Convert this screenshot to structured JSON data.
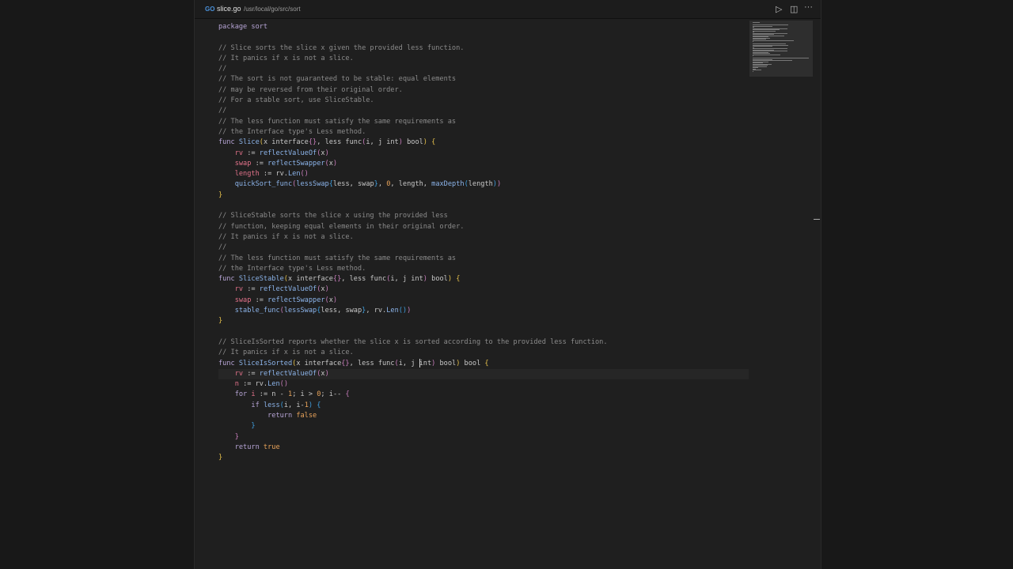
{
  "tab": {
    "icon": "GO",
    "file_name": "slice.go",
    "path": "/usr/local/go/src/sort"
  },
  "toolbar": {
    "run_icon": "play-icon",
    "split_icon": "split-editor-icon",
    "more_icon": "more-icon"
  },
  "colors": {
    "background": "#1f1f1f",
    "comment": "#8b8b8b",
    "keyword": "#b7a5d6",
    "function": "#8cb4ea",
    "variable": "#e2728a",
    "number": "#e8a35a"
  },
  "cursor_line": 33,
  "lines": [
    [
      [
        "package sort",
        "k"
      ]
    ],
    [],
    [
      [
        "// Slice sorts the slice x given the provided less function.",
        "c"
      ]
    ],
    [
      [
        "// It panics if x is not a slice.",
        "c"
      ]
    ],
    [
      [
        "//",
        "c"
      ]
    ],
    [
      [
        "// The sort is not guaranteed to be stable: equal elements",
        "c"
      ]
    ],
    [
      [
        "// may be reversed from their original order.",
        "c"
      ]
    ],
    [
      [
        "// For a stable sort, use SliceStable.",
        "c"
      ]
    ],
    [
      [
        "//",
        "c"
      ]
    ],
    [
      [
        "// The less function must satisfy the same requirements as",
        "c"
      ]
    ],
    [
      [
        "// the Interface type's Less method.",
        "c"
      ]
    ],
    [
      [
        "func ",
        "k"
      ],
      [
        "Slice",
        "f"
      ],
      [
        "(",
        "b1"
      ],
      [
        "x interface",
        "p"
      ],
      [
        "{}",
        "b2"
      ],
      [
        ", less func",
        "p"
      ],
      [
        "(",
        "b2"
      ],
      [
        "i, j int",
        "p"
      ],
      [
        ")",
        "b2"
      ],
      [
        " bool",
        "p"
      ],
      [
        ")",
        "b1"
      ],
      [
        " {",
        "b1"
      ]
    ],
    [
      [
        "    "
      ],
      [
        "rv",
        "v"
      ],
      [
        " := ",
        "p"
      ],
      [
        "reflectValueOf",
        "f"
      ],
      [
        "(",
        "b2"
      ],
      [
        "x",
        "p"
      ],
      [
        ")",
        "b2"
      ]
    ],
    [
      [
        "    "
      ],
      [
        "swap",
        "v"
      ],
      [
        " := ",
        "p"
      ],
      [
        "reflectSwapper",
        "f"
      ],
      [
        "(",
        "b2"
      ],
      [
        "x",
        "p"
      ],
      [
        ")",
        "b2"
      ]
    ],
    [
      [
        "    "
      ],
      [
        "length",
        "v"
      ],
      [
        " := rv.",
        "p"
      ],
      [
        "Len",
        "f"
      ],
      [
        "()",
        "b2"
      ]
    ],
    [
      [
        "    "
      ],
      [
        "quickSort_func",
        "f"
      ],
      [
        "(",
        "b2"
      ],
      [
        "lessSwap",
        "f"
      ],
      [
        "{",
        "b3"
      ],
      [
        "less, swap",
        "p"
      ],
      [
        "}",
        "b3"
      ],
      [
        ", ",
        "p"
      ],
      [
        "0",
        "n"
      ],
      [
        ", length, ",
        "p"
      ],
      [
        "maxDepth",
        "f"
      ],
      [
        "(",
        "b3"
      ],
      [
        "length",
        "p"
      ],
      [
        ")",
        "b3"
      ],
      [
        ")",
        "b2"
      ]
    ],
    [
      [
        "}",
        "b1"
      ]
    ],
    [],
    [
      [
        "// SliceStable sorts the slice x using the provided less",
        "c"
      ]
    ],
    [
      [
        "// function, keeping equal elements in their original order.",
        "c"
      ]
    ],
    [
      [
        "// It panics if x is not a slice.",
        "c"
      ]
    ],
    [
      [
        "//",
        "c"
      ]
    ],
    [
      [
        "// The less function must satisfy the same requirements as",
        "c"
      ]
    ],
    [
      [
        "// the Interface type's Less method.",
        "c"
      ]
    ],
    [
      [
        "func ",
        "k"
      ],
      [
        "SliceStable",
        "f"
      ],
      [
        "(",
        "b1"
      ],
      [
        "x interface",
        "p"
      ],
      [
        "{}",
        "b2"
      ],
      [
        ", less func",
        "p"
      ],
      [
        "(",
        "b2"
      ],
      [
        "i, j int",
        "p"
      ],
      [
        ")",
        "b2"
      ],
      [
        " bool",
        "p"
      ],
      [
        ")",
        "b1"
      ],
      [
        " {",
        "b1"
      ]
    ],
    [
      [
        "    "
      ],
      [
        "rv",
        "v"
      ],
      [
        " := ",
        "p"
      ],
      [
        "reflectValueOf",
        "f"
      ],
      [
        "(",
        "b2"
      ],
      [
        "x",
        "p"
      ],
      [
        ")",
        "b2"
      ]
    ],
    [
      [
        "    "
      ],
      [
        "swap",
        "v"
      ],
      [
        " := ",
        "p"
      ],
      [
        "reflectSwapper",
        "f"
      ],
      [
        "(",
        "b2"
      ],
      [
        "x",
        "p"
      ],
      [
        ")",
        "b2"
      ]
    ],
    [
      [
        "    "
      ],
      [
        "stable_func",
        "f"
      ],
      [
        "(",
        "b2"
      ],
      [
        "lessSwap",
        "f"
      ],
      [
        "{",
        "b3"
      ],
      [
        "less, swap",
        "p"
      ],
      [
        "}",
        "b3"
      ],
      [
        ", rv.",
        "p"
      ],
      [
        "Len",
        "f"
      ],
      [
        "()",
        "b3"
      ],
      [
        ")",
        "b2"
      ]
    ],
    [
      [
        "}",
        "b1"
      ]
    ],
    [],
    [
      [
        "// SliceIsSorted reports whether the slice x is sorted according to the provided less function.",
        "c"
      ]
    ],
    [
      [
        "// It panics if x is not a slice.",
        "c"
      ]
    ],
    [
      [
        "func ",
        "k"
      ],
      [
        "SliceIsSorted",
        "f"
      ],
      [
        "(",
        "b1"
      ],
      [
        "x interface",
        "p"
      ],
      [
        "{}",
        "b2"
      ],
      [
        ", less func",
        "p"
      ],
      [
        "(",
        "b2"
      ],
      [
        "i, j ",
        "p"
      ],
      [
        "|",
        ""
      ],
      [
        "int",
        "p"
      ],
      [
        ")",
        "b2"
      ],
      [
        " bool",
        "p"
      ],
      [
        ")",
        "b1"
      ],
      [
        " bool ",
        "p"
      ],
      [
        "{",
        "b1"
      ]
    ],
    [
      [
        "    "
      ],
      [
        "rv",
        "v"
      ],
      [
        " := ",
        "p"
      ],
      [
        "reflectValueOf",
        "f"
      ],
      [
        "(",
        "b2"
      ],
      [
        "x",
        "p"
      ],
      [
        ")",
        "b2"
      ]
    ],
    [
      [
        "    "
      ],
      [
        "n",
        "v"
      ],
      [
        " := rv.",
        "p"
      ],
      [
        "Len",
        "f"
      ],
      [
        "()",
        "b2"
      ]
    ],
    [
      [
        "    "
      ],
      [
        "for ",
        "k"
      ],
      [
        "i",
        "v"
      ],
      [
        " := n - ",
        "p"
      ],
      [
        "1",
        "n"
      ],
      [
        "; i > ",
        "p"
      ],
      [
        "0",
        "n"
      ],
      [
        "; i-- ",
        "p"
      ],
      [
        "{",
        "b2"
      ]
    ],
    [
      [
        "        "
      ],
      [
        "if ",
        "k"
      ],
      [
        "less",
        "f"
      ],
      [
        "(",
        "b3"
      ],
      [
        "i, i-",
        "p"
      ],
      [
        "1",
        "n"
      ],
      [
        ")",
        "b3"
      ],
      [
        " {",
        "b3"
      ]
    ],
    [
      [
        "            "
      ],
      [
        "return ",
        "k"
      ],
      [
        "false",
        "n"
      ]
    ],
    [
      [
        "        "
      ],
      [
        "}",
        "b3"
      ]
    ],
    [
      [
        "    "
      ],
      [
        "}",
        "b2"
      ]
    ],
    [
      [
        "    "
      ],
      [
        "return ",
        "k"
      ],
      [
        "true",
        "n"
      ]
    ],
    [
      [
        "}",
        "b1"
      ]
    ]
  ]
}
